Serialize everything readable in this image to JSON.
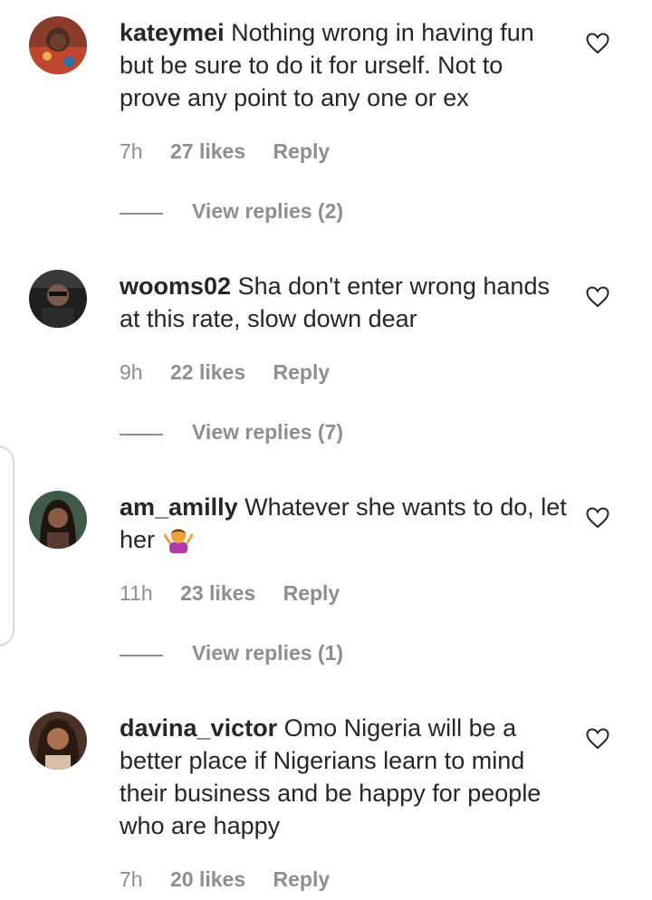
{
  "comments": [
    {
      "username": "kateymei",
      "text": "Nothing wrong in having fun but be sure to do it for urself. Not to prove any point to any one or ex",
      "time": "7h",
      "likes": "27 likes",
      "reply": "Reply",
      "view_replies": "View replies (2)",
      "avatar_icon": "avatar-photo"
    },
    {
      "username": "wooms02",
      "text": "Sha don't enter wrong hands at this rate, slow down dear",
      "time": "9h",
      "likes": "22 likes",
      "reply": "Reply",
      "view_replies": "View replies (7)",
      "avatar_icon": "avatar-photo"
    },
    {
      "username": "am_amilly",
      "text": "Whatever she wants to do, let her",
      "emoji": "person-shrugging-emoji",
      "time": "11h",
      "likes": "23 likes",
      "reply": "Reply",
      "view_replies": "View replies (1)",
      "avatar_icon": "avatar-photo"
    },
    {
      "username": "davina_victor",
      "text": "Omo Nigeria will be a better place if Nigerians learn to mind their business and be happy for people who are happy",
      "time": "7h",
      "likes": "20 likes",
      "reply": "Reply",
      "avatar_icon": "avatar-photo"
    }
  ],
  "icons": {
    "like": "heart-outline-icon"
  },
  "colors": {
    "text": "#262626",
    "muted": "#8e8e8e",
    "background": "#ffffff"
  }
}
